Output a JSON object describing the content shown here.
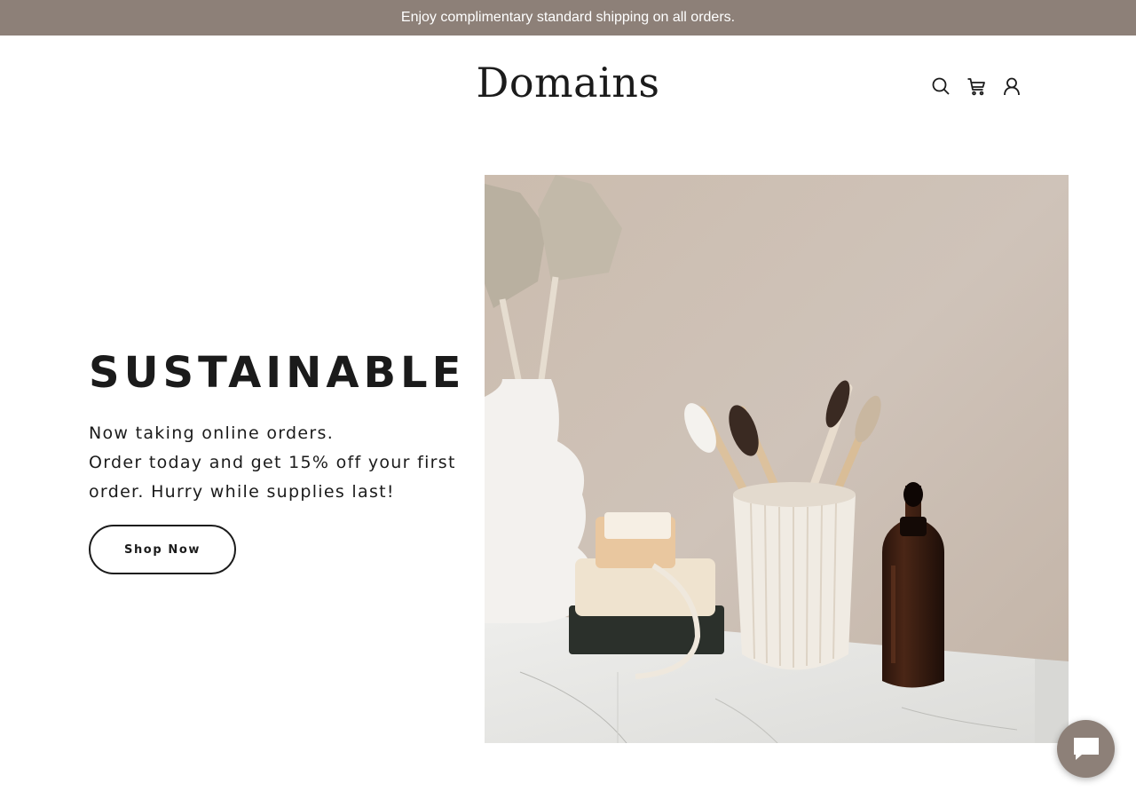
{
  "announcement": "Enjoy complimentary standard shipping on all orders.",
  "header": {
    "logo": "Domains",
    "icons": [
      "search-icon",
      "cart-icon",
      "account-icon"
    ]
  },
  "hero": {
    "title": "SUSTAINABLE",
    "lines": [
      "Now taking online orders.",
      "Order today and get 15% off your first",
      "order. Hurry while supplies last!"
    ],
    "button_label": "Shop Now",
    "image_alt": "Bamboo toothbrushes in a ribbed ceramic cup, soap, brush, dropper bottle and vase of dried palm leaves on a marble shelf"
  },
  "chat": {
    "icon": "chat-icon"
  },
  "colors": {
    "accent": "#8d8078",
    "text": "#1b1b1b",
    "background": "#ffffff"
  }
}
